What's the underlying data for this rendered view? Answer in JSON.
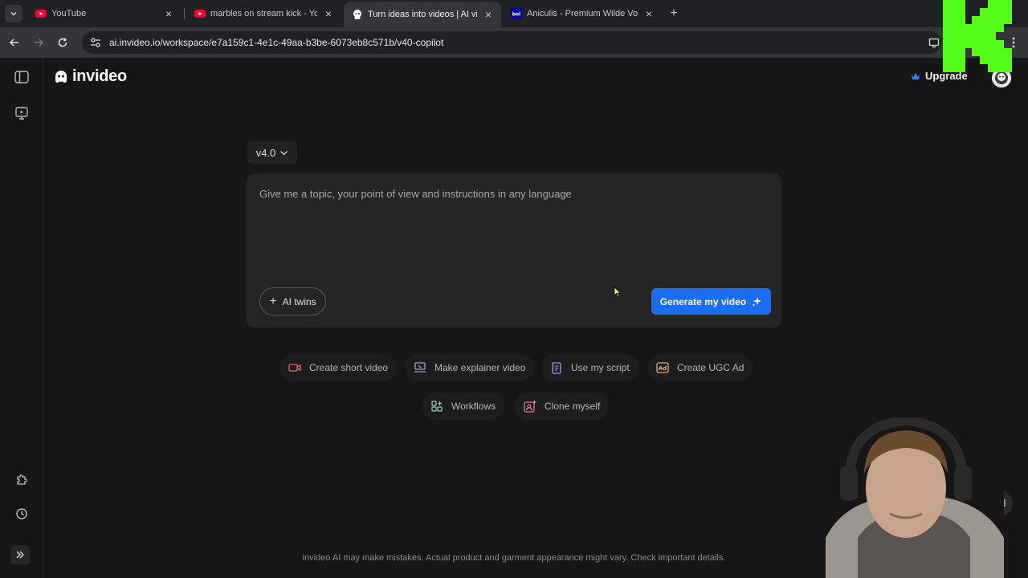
{
  "browser": {
    "tabs": [
      {
        "title": "YouTube",
        "favicon": "youtube-icon",
        "active": false
      },
      {
        "title": "marbles on stream kick - YouTube",
        "favicon": "youtube-icon",
        "active": false
      },
      {
        "title": "Turn ideas into videos | AI video",
        "favicon": "invideo-icon",
        "active": true
      },
      {
        "title": "Aniculis - Premium Wilde Vogel",
        "favicon": "bol-icon",
        "active": false
      }
    ],
    "url": "ai.invideo.io/workspace/e7a159c1-4e1c-49aa-b3be-6073eb8c571b/v40-copilot"
  },
  "header": {
    "logo_text": "invideo",
    "upgrade_label": "Upgrade"
  },
  "composer": {
    "version_label": "v4.0",
    "placeholder": "Give me a topic, your point of view and instructions in any language",
    "value": "",
    "ai_twins_label": "AI twins",
    "generate_label": "Generate my video"
  },
  "quick_actions": [
    {
      "label": "Create short video",
      "icon": "video-camera-icon"
    },
    {
      "label": "Make explainer video",
      "icon": "screen-pointer-icon"
    },
    {
      "label": "Use my script",
      "icon": "document-icon"
    },
    {
      "label": "Create UGC Ad",
      "icon": "ad-icon"
    },
    {
      "label": "Workflows",
      "icon": "grid-sparkle-icon"
    },
    {
      "label": "Clone myself",
      "icon": "clone-icon"
    }
  ],
  "footer": {
    "disclaimer": "invideo AI may make mistakes. Actual product and garment appearance might vary. Check important details."
  },
  "colors": {
    "background": "#161616",
    "card": "#252525",
    "accent": "#1a6ff0",
    "stream_logo": "#53fc18"
  }
}
